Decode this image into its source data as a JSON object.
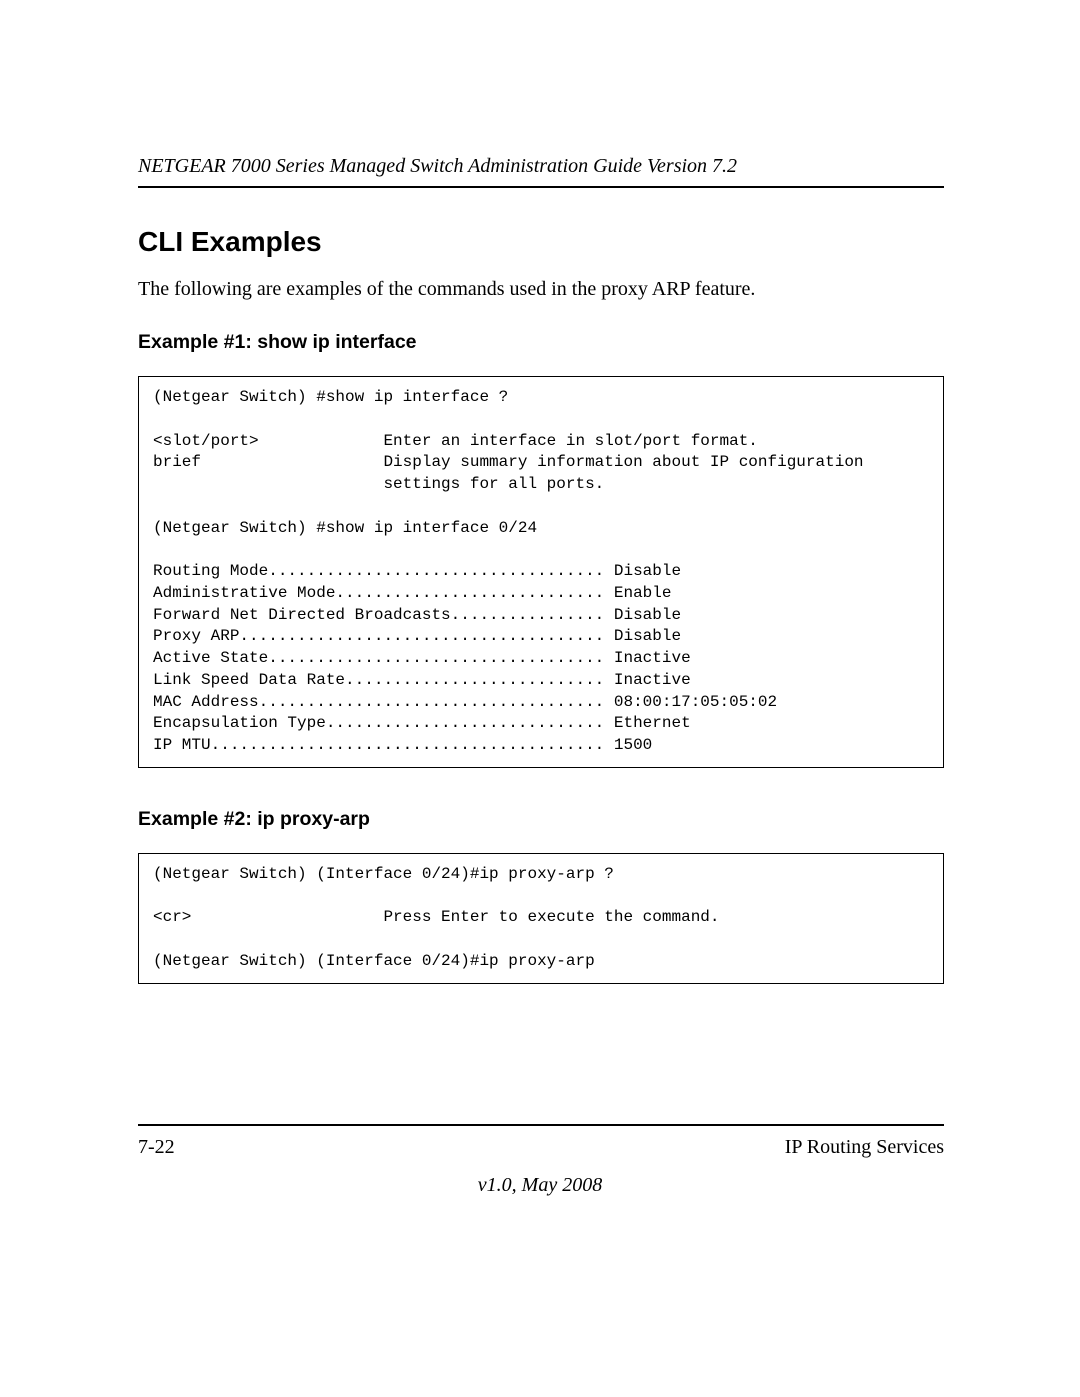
{
  "header": {
    "title": "NETGEAR 7000 Series Managed Switch Administration Guide Version 7.2"
  },
  "section": {
    "h1": "CLI Examples",
    "intro": "The following are examples of the commands used in the proxy ARP feature."
  },
  "example1": {
    "heading": "Example #1: show ip interface",
    "code": "(Netgear Switch) #show ip interface ?\n\n<slot/port>             Enter an interface in slot/port format.\nbrief                   Display summary information about IP configuration\n                        settings for all ports.\n\n(Netgear Switch) #show ip interface 0/24\n\nRouting Mode................................... Disable\nAdministrative Mode............................ Enable\nForward Net Directed Broadcasts................ Disable\nProxy ARP...................................... Disable\nActive State................................... Inactive\nLink Speed Data Rate........................... Inactive\nMAC Address.................................... 08:00:17:05:05:02\nEncapsulation Type............................. Ethernet\nIP MTU......................................... 1500"
  },
  "example2": {
    "heading": "Example #2: ip proxy-arp",
    "code": "(Netgear Switch) (Interface 0/24)#ip proxy-arp ?\n\n<cr>                    Press Enter to execute the command.\n\n(Netgear Switch) (Interface 0/24)#ip proxy-arp"
  },
  "footer": {
    "page": "7-22",
    "section": "IP Routing Services",
    "version": "v1.0, May 2008"
  }
}
